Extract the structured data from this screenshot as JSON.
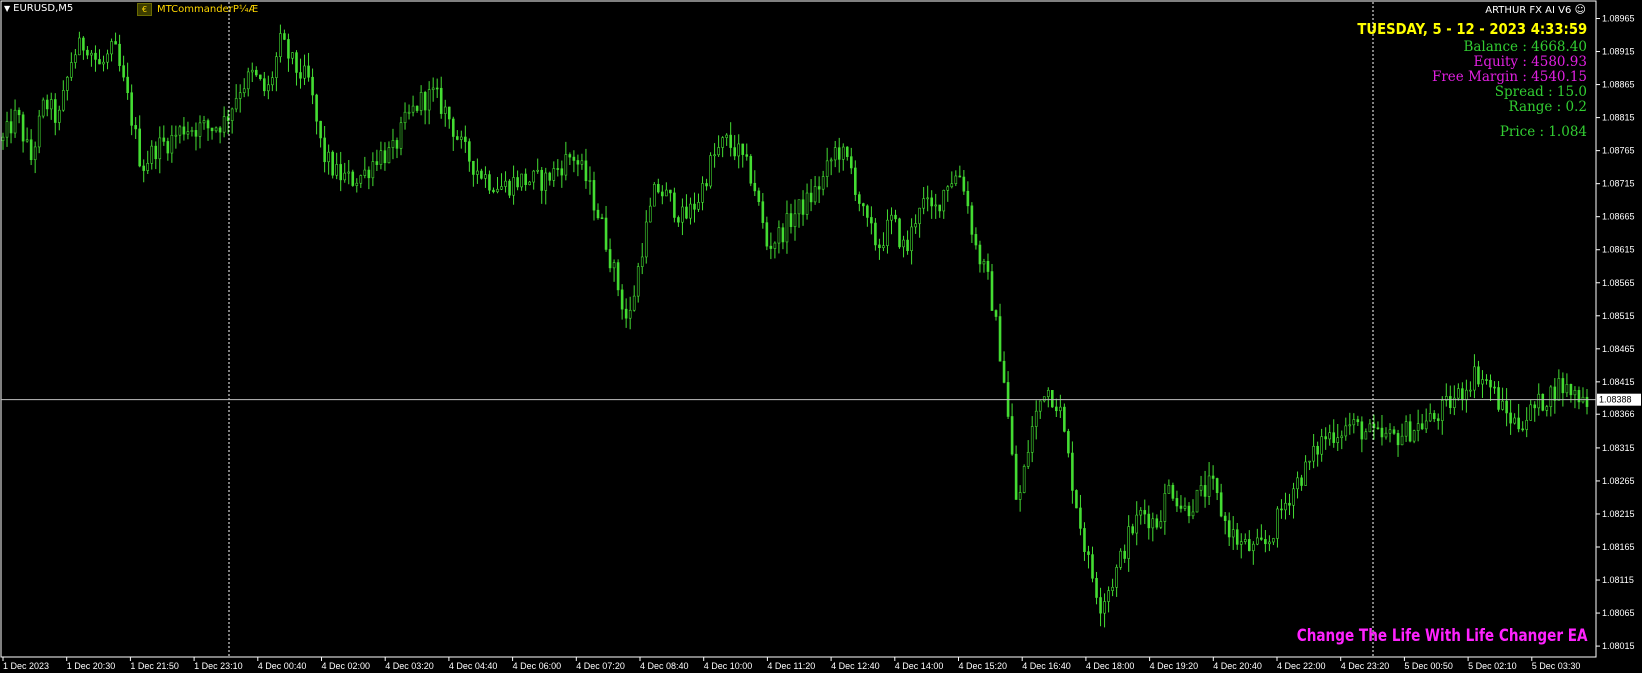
{
  "window": {
    "symbol": "EURUSD,M5",
    "indicator_label": "MTCommander",
    "indicator_suffix": "P¼Æ",
    "indicator_badge": "€",
    "ea_name": "ARTHUR FX AI V6",
    "smiley": "☺"
  },
  "hud": {
    "date_time": "TUESDAY, 5 - 12 - 2023 4:33:59",
    "balance": "Balance   : 4668.40",
    "equity": "Equity      : 4580.93",
    "free_margin": "Free Margin     : 4540.15",
    "spread": "Spread   : 15.0",
    "range": "Range : 0.2",
    "price": "Price : 1.084",
    "colors": {
      "date": "#ffff00",
      "balance": "#32cd32",
      "equity": "#e020e0",
      "free_margin": "#e020e0",
      "spread": "#32cd32",
      "range": "#32cd32",
      "price": "#32cd32"
    }
  },
  "footer": {
    "slogan": "Change The Life With Life Changer EA"
  },
  "chart_data": {
    "type": "candlestick",
    "symbol": "EURUSD",
    "timeframe": "M5",
    "current_price_label": "1.08388",
    "ylim": [
      1.08,
      1.0899
    ],
    "y_ticks": [
      "1.08965",
      "1.08915",
      "1.08865",
      "1.08815",
      "1.08765",
      "1.08715",
      "1.08665",
      "1.08615",
      "1.08565",
      "1.08515",
      "1.08465",
      "1.08415",
      "1.08366",
      "1.08315",
      "1.08265",
      "1.08215",
      "1.08165",
      "1.08115",
      "1.08065",
      "1.08015"
    ],
    "x_ticks": [
      "1 Dec 2023",
      "1 Dec 20:30",
      "1 Dec 21:50",
      "1 Dec 23:10",
      "4 Dec 00:40",
      "4 Dec 02:00",
      "4 Dec 03:20",
      "4 Dec 04:40",
      "4 Dec 06:00",
      "4 Dec 07:20",
      "4 Dec 08:40",
      "4 Dec 10:00",
      "4 Dec 11:20",
      "4 Dec 12:40",
      "4 Dec 14:00",
      "4 Dec 15:20",
      "4 Dec 16:40",
      "4 Dec 18:00",
      "4 Dec 19:20",
      "4 Dec 20:40",
      "4 Dec 22:00",
      "4 Dec 23:20",
      "5 Dec 00:50",
      "5 Dec 02:10",
      "5 Dec 03:30"
    ],
    "close_path": [
      [
        0,
        1.0878
      ],
      [
        2,
        1.0882
      ],
      [
        4,
        1.0875
      ],
      [
        6,
        1.0884
      ],
      [
        8,
        1.0881
      ],
      [
        10,
        1.0891
      ],
      [
        12,
        1.0893
      ],
      [
        14,
        1.0889
      ],
      [
        16,
        1.0892
      ],
      [
        18,
        1.0884
      ],
      [
        20,
        1.0874
      ],
      [
        22,
        1.0877
      ],
      [
        24,
        1.0878
      ],
      [
        26,
        1.088
      ],
      [
        28,
        1.088
      ],
      [
        30,
        1.088
      ],
      [
        32,
        1.0881
      ],
      [
        34,
        1.0886
      ],
      [
        36,
        1.0888
      ],
      [
        38,
        1.0885
      ],
      [
        40,
        1.0893
      ],
      [
        42,
        1.0889
      ],
      [
        44,
        1.0887
      ],
      [
        46,
        1.0876
      ],
      [
        48,
        1.0873
      ],
      [
        50,
        1.0872
      ],
      [
        52,
        1.0873
      ],
      [
        54,
        1.0876
      ],
      [
        56,
        1.0876
      ],
      [
        58,
        1.0881
      ],
      [
        60,
        1.0884
      ],
      [
        62,
        1.0885
      ],
      [
        64,
        1.0882
      ],
      [
        66,
        1.0877
      ],
      [
        68,
        1.0874
      ],
      [
        70,
        1.0872
      ],
      [
        72,
        1.0871
      ],
      [
        74,
        1.0872
      ],
      [
        76,
        1.0872
      ],
      [
        78,
        1.0872
      ],
      [
        80,
        1.0874
      ],
      [
        82,
        1.0876
      ],
      [
        84,
        1.0872
      ],
      [
        86,
        1.0866
      ],
      [
        88,
        1.0858
      ],
      [
        90,
        1.085
      ],
      [
        92,
        1.0862
      ],
      [
        94,
        1.0871
      ],
      [
        96,
        1.0869
      ],
      [
        98,
        1.0866
      ],
      [
        100,
        1.0869
      ],
      [
        102,
        1.0875
      ],
      [
        104,
        1.0878
      ],
      [
        106,
        1.0876
      ],
      [
        108,
        1.0872
      ],
      [
        110,
        1.0862
      ],
      [
        112,
        1.0864
      ],
      [
        114,
        1.0867
      ],
      [
        116,
        1.0869
      ],
      [
        118,
        1.0872
      ],
      [
        120,
        1.0877
      ],
      [
        122,
        1.0874
      ],
      [
        124,
        1.0866
      ],
      [
        126,
        1.0862
      ],
      [
        128,
        1.0866
      ],
      [
        130,
        1.0861
      ],
      [
        132,
        1.0869
      ],
      [
        134,
        1.0867
      ],
      [
        136,
        1.0872
      ],
      [
        138,
        1.0873
      ],
      [
        140,
        1.0862
      ],
      [
        142,
        1.0856
      ],
      [
        144,
        1.0843
      ],
      [
        146,
        1.0822
      ],
      [
        148,
        1.0834
      ],
      [
        150,
        1.0841
      ],
      [
        152,
        1.0838
      ],
      [
        154,
        1.0826
      ],
      [
        156,
        1.0815
      ],
      [
        158,
        1.0808
      ],
      [
        160,
        1.0812
      ],
      [
        162,
        1.0818
      ],
      [
        164,
        1.0822
      ],
      [
        166,
        1.082
      ],
      [
        168,
        1.0826
      ],
      [
        170,
        1.0822
      ],
      [
        172,
        1.0824
      ],
      [
        174,
        1.0826
      ],
      [
        176,
        1.082
      ],
      [
        178,
        1.0817
      ],
      [
        180,
        1.0816
      ],
      [
        182,
        1.0817
      ],
      [
        184,
        1.0822
      ],
      [
        186,
        1.0826
      ],
      [
        188,
        1.0829
      ],
      [
        190,
        1.0833
      ],
      [
        192,
        1.0834
      ],
      [
        194,
        1.0835
      ],
      [
        196,
        1.0834
      ],
      [
        198,
        1.0833
      ],
      [
        200,
        1.0833
      ],
      [
        202,
        1.0834
      ],
      [
        204,
        1.0835
      ],
      [
        206,
        1.0836
      ],
      [
        208,
        1.0838
      ],
      [
        210,
        1.084
      ],
      [
        212,
        1.0843
      ],
      [
        214,
        1.0841
      ],
      [
        216,
        1.0837
      ],
      [
        218,
        1.0835
      ],
      [
        220,
        1.0837
      ],
      [
        222,
        1.0839
      ],
      [
        224,
        1.0841
      ],
      [
        226,
        1.084
      ],
      [
        228,
        1.0839
      ]
    ],
    "grid": false,
    "crosshair": {
      "price": 1.08388,
      "time": "1 Dec 23:10 / 4 Dec 23:20"
    }
  }
}
